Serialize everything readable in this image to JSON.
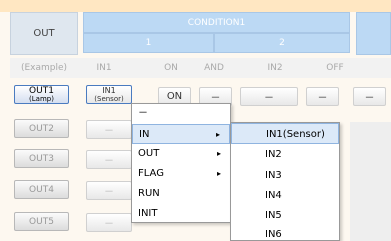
{
  "header": {
    "out": "OUT",
    "condition": "CONDITION1",
    "col1": "1",
    "col2": "2"
  },
  "example": {
    "label": "(Example)",
    "in1": "IN1",
    "on": "ON",
    "and": "AND",
    "in2": "IN2",
    "off": "OFF"
  },
  "rows": [
    {
      "out": "OUT1",
      "sub": "(Lamp)",
      "in": "IN1",
      "insub": "(Sensor)",
      "state": "ON",
      "c4": "－",
      "c5": "－",
      "c6": "－",
      "c7": "－"
    },
    {
      "out": "OUT2",
      "c1": "－"
    },
    {
      "out": "OUT3",
      "c1": "－"
    },
    {
      "out": "OUT4",
      "c1": "－"
    },
    {
      "out": "OUT5",
      "c1": "－"
    }
  ],
  "menu": {
    "items": [
      "－",
      "IN",
      "OUT",
      "FLAG",
      "RUN",
      "INIT"
    ],
    "arrow": "▸"
  },
  "submenu": {
    "items": [
      "IN1(Sensor)",
      "IN2",
      "IN3",
      "IN4",
      "IN5",
      "IN6"
    ]
  }
}
